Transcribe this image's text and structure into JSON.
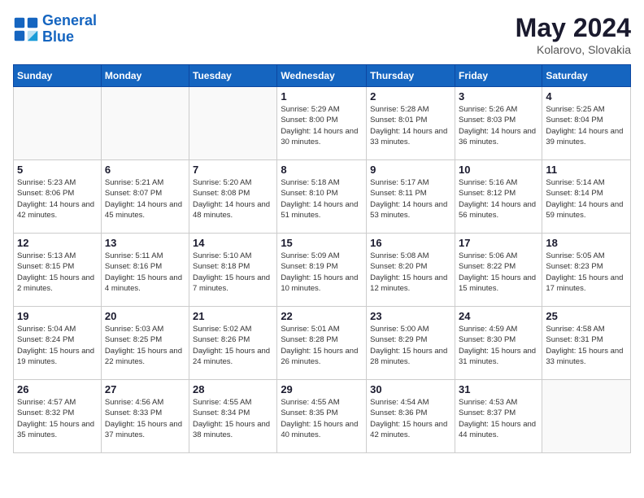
{
  "header": {
    "logo_line1": "General",
    "logo_line2": "Blue",
    "month": "May 2024",
    "location": "Kolarovo, Slovakia"
  },
  "weekdays": [
    "Sunday",
    "Monday",
    "Tuesday",
    "Wednesday",
    "Thursday",
    "Friday",
    "Saturday"
  ],
  "weeks": [
    [
      {
        "day": "",
        "info": ""
      },
      {
        "day": "",
        "info": ""
      },
      {
        "day": "",
        "info": ""
      },
      {
        "day": "1",
        "info": "Sunrise: 5:29 AM\nSunset: 8:00 PM\nDaylight: 14 hours\nand 30 minutes."
      },
      {
        "day": "2",
        "info": "Sunrise: 5:28 AM\nSunset: 8:01 PM\nDaylight: 14 hours\nand 33 minutes."
      },
      {
        "day": "3",
        "info": "Sunrise: 5:26 AM\nSunset: 8:03 PM\nDaylight: 14 hours\nand 36 minutes."
      },
      {
        "day": "4",
        "info": "Sunrise: 5:25 AM\nSunset: 8:04 PM\nDaylight: 14 hours\nand 39 minutes."
      }
    ],
    [
      {
        "day": "5",
        "info": "Sunrise: 5:23 AM\nSunset: 8:06 PM\nDaylight: 14 hours\nand 42 minutes."
      },
      {
        "day": "6",
        "info": "Sunrise: 5:21 AM\nSunset: 8:07 PM\nDaylight: 14 hours\nand 45 minutes."
      },
      {
        "day": "7",
        "info": "Sunrise: 5:20 AM\nSunset: 8:08 PM\nDaylight: 14 hours\nand 48 minutes."
      },
      {
        "day": "8",
        "info": "Sunrise: 5:18 AM\nSunset: 8:10 PM\nDaylight: 14 hours\nand 51 minutes."
      },
      {
        "day": "9",
        "info": "Sunrise: 5:17 AM\nSunset: 8:11 PM\nDaylight: 14 hours\nand 53 minutes."
      },
      {
        "day": "10",
        "info": "Sunrise: 5:16 AM\nSunset: 8:12 PM\nDaylight: 14 hours\nand 56 minutes."
      },
      {
        "day": "11",
        "info": "Sunrise: 5:14 AM\nSunset: 8:14 PM\nDaylight: 14 hours\nand 59 minutes."
      }
    ],
    [
      {
        "day": "12",
        "info": "Sunrise: 5:13 AM\nSunset: 8:15 PM\nDaylight: 15 hours\nand 2 minutes."
      },
      {
        "day": "13",
        "info": "Sunrise: 5:11 AM\nSunset: 8:16 PM\nDaylight: 15 hours\nand 4 minutes."
      },
      {
        "day": "14",
        "info": "Sunrise: 5:10 AM\nSunset: 8:18 PM\nDaylight: 15 hours\nand 7 minutes."
      },
      {
        "day": "15",
        "info": "Sunrise: 5:09 AM\nSunset: 8:19 PM\nDaylight: 15 hours\nand 10 minutes."
      },
      {
        "day": "16",
        "info": "Sunrise: 5:08 AM\nSunset: 8:20 PM\nDaylight: 15 hours\nand 12 minutes."
      },
      {
        "day": "17",
        "info": "Sunrise: 5:06 AM\nSunset: 8:22 PM\nDaylight: 15 hours\nand 15 minutes."
      },
      {
        "day": "18",
        "info": "Sunrise: 5:05 AM\nSunset: 8:23 PM\nDaylight: 15 hours\nand 17 minutes."
      }
    ],
    [
      {
        "day": "19",
        "info": "Sunrise: 5:04 AM\nSunset: 8:24 PM\nDaylight: 15 hours\nand 19 minutes."
      },
      {
        "day": "20",
        "info": "Sunrise: 5:03 AM\nSunset: 8:25 PM\nDaylight: 15 hours\nand 22 minutes."
      },
      {
        "day": "21",
        "info": "Sunrise: 5:02 AM\nSunset: 8:26 PM\nDaylight: 15 hours\nand 24 minutes."
      },
      {
        "day": "22",
        "info": "Sunrise: 5:01 AM\nSunset: 8:28 PM\nDaylight: 15 hours\nand 26 minutes."
      },
      {
        "day": "23",
        "info": "Sunrise: 5:00 AM\nSunset: 8:29 PM\nDaylight: 15 hours\nand 28 minutes."
      },
      {
        "day": "24",
        "info": "Sunrise: 4:59 AM\nSunset: 8:30 PM\nDaylight: 15 hours\nand 31 minutes."
      },
      {
        "day": "25",
        "info": "Sunrise: 4:58 AM\nSunset: 8:31 PM\nDaylight: 15 hours\nand 33 minutes."
      }
    ],
    [
      {
        "day": "26",
        "info": "Sunrise: 4:57 AM\nSunset: 8:32 PM\nDaylight: 15 hours\nand 35 minutes."
      },
      {
        "day": "27",
        "info": "Sunrise: 4:56 AM\nSunset: 8:33 PM\nDaylight: 15 hours\nand 37 minutes."
      },
      {
        "day": "28",
        "info": "Sunrise: 4:55 AM\nSunset: 8:34 PM\nDaylight: 15 hours\nand 38 minutes."
      },
      {
        "day": "29",
        "info": "Sunrise: 4:55 AM\nSunset: 8:35 PM\nDaylight: 15 hours\nand 40 minutes."
      },
      {
        "day": "30",
        "info": "Sunrise: 4:54 AM\nSunset: 8:36 PM\nDaylight: 15 hours\nand 42 minutes."
      },
      {
        "day": "31",
        "info": "Sunrise: 4:53 AM\nSunset: 8:37 PM\nDaylight: 15 hours\nand 44 minutes."
      },
      {
        "day": "",
        "info": ""
      }
    ]
  ]
}
